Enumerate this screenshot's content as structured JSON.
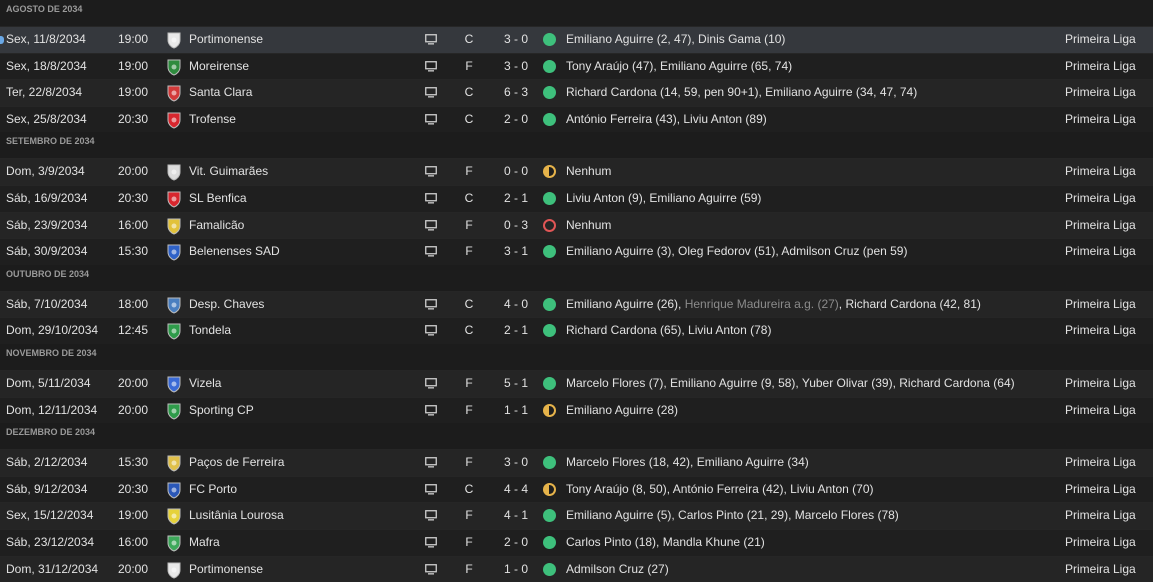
{
  "colors": {
    "win": "#3ec07c",
    "draw": "#e6b34a",
    "loss": "#e05656",
    "selected_row": "#35383d"
  },
  "icons": {
    "tv": "tv-icon",
    "badge": "club-badge-icon"
  },
  "months": [
    {
      "label": "AGOSTO DE 2034",
      "matches": [
        {
          "date": "Sex, 11/8/2034",
          "time": "19:00",
          "opponent": "Portimonense",
          "badge_color": "#e9e9e9",
          "venue": "C",
          "score": "3 - 0",
          "result": "win",
          "scorers": "Emiliano Aguirre (2, 47), Dinis Gama (10)",
          "competition": "Primeira Liga",
          "selected": true
        },
        {
          "date": "Sex, 18/8/2034",
          "time": "19:00",
          "opponent": "Moreirense",
          "badge_color": "#2e8b3e",
          "venue": "F",
          "score": "3 - 0",
          "result": "win",
          "scorers": "Tony Araújo (47), Emiliano Aguirre (65, 74)",
          "competition": "Primeira Liga"
        },
        {
          "date": "Ter, 22/8/2034",
          "time": "19:00",
          "opponent": "Santa Clara",
          "badge_color": "#d23a3a",
          "venue": "C",
          "score": "6 - 3",
          "result": "win",
          "scorers": "Richard Cardona (14, 59, pen 90+1), Emiliano Aguirre (34, 47, 74)",
          "competition": "Primeira Liga"
        },
        {
          "date": "Sex, 25/8/2034",
          "time": "20:30",
          "opponent": "Trofense",
          "badge_color": "#d8262e",
          "venue": "C",
          "score": "2 - 0",
          "result": "win",
          "scorers": "António Ferreira (43), Liviu Anton (89)",
          "competition": "Primeira Liga"
        }
      ]
    },
    {
      "label": "SETEMBRO DE 2034",
      "matches": [
        {
          "date": "Dom, 3/9/2034",
          "time": "20:00",
          "opponent": "Vit. Guimarães",
          "badge_color": "#dcdcdc",
          "venue": "F",
          "score": "0 - 0",
          "result": "draw",
          "scorers": "Nenhum",
          "competition": "Primeira Liga"
        },
        {
          "date": "Sáb, 16/9/2034",
          "time": "20:30",
          "opponent": "SL Benfica",
          "badge_color": "#d8262e",
          "venue": "C",
          "score": "2 - 1",
          "result": "win",
          "scorers": "Liviu Anton (9), Emiliano Aguirre (59)",
          "competition": "Primeira Liga"
        },
        {
          "date": "Sáb, 23/9/2034",
          "time": "16:00",
          "opponent": "Famalicão",
          "badge_color": "#e2c23a",
          "venue": "F",
          "score": "0 - 3",
          "result": "loss",
          "scorers": "Nenhum",
          "competition": "Primeira Liga"
        },
        {
          "date": "Sáb, 30/9/2034",
          "time": "15:30",
          "opponent": "Belenenses SAD",
          "badge_color": "#2f62c8",
          "venue": "F",
          "score": "3 - 1",
          "result": "win",
          "scorers": "Emiliano Aguirre (3), Oleg Fedorov (51), Admilson Cruz (pen 59)",
          "competition": "Primeira Liga"
        }
      ]
    },
    {
      "label": "OUTUBRO DE 2034",
      "matches": [
        {
          "date": "Sáb, 7/10/2034",
          "time": "18:00",
          "opponent": "Desp. Chaves",
          "badge_color": "#4a7fc0",
          "venue": "C",
          "score": "4 - 0",
          "result": "win",
          "scorers": "Emiliano Aguirre (26), ",
          "scorers_og": "Henrique Madureira a.g. (27)",
          "scorers_tail": ", Richard Cardona (42, 81)",
          "competition": "Primeira Liga"
        },
        {
          "date": "Dom, 29/10/2034",
          "time": "12:45",
          "opponent": "Tondela",
          "badge_color": "#2e9b4a",
          "venue": "C",
          "score": "2 - 1",
          "result": "win",
          "scorers": "Richard Cardona (65), Liviu Anton (78)",
          "competition": "Primeira Liga"
        }
      ]
    },
    {
      "label": "NOVEMBRO DE 2034",
      "matches": [
        {
          "date": "Dom, 5/11/2034",
          "time": "20:00",
          "opponent": "Vizela",
          "badge_color": "#3a6ad6",
          "venue": "F",
          "score": "5 - 1",
          "result": "win",
          "scorers": "Marcelo Flores (7), Emiliano Aguirre (9, 58), Yuber Olivar (39), Richard Cardona (64)",
          "competition": "Primeira Liga"
        },
        {
          "date": "Dom, 12/11/2034",
          "time": "20:00",
          "opponent": "Sporting CP",
          "badge_color": "#2e9b4a",
          "venue": "F",
          "score": "1 - 1",
          "result": "draw",
          "scorers": "Emiliano Aguirre (28)",
          "competition": "Primeira Liga"
        }
      ]
    },
    {
      "label": "DEZEMBRO DE 2034",
      "matches": [
        {
          "date": "Sáb, 2/12/2034",
          "time": "15:30",
          "opponent": "Paços de Ferreira",
          "badge_color": "#e0c04a",
          "venue": "F",
          "score": "3 - 0",
          "result": "win",
          "scorers": "Marcelo Flores (18, 42), Emiliano Aguirre (34)",
          "competition": "Primeira Liga"
        },
        {
          "date": "Sáb, 9/12/2034",
          "time": "20:30",
          "opponent": "FC Porto",
          "badge_color": "#2a57b8",
          "venue": "C",
          "score": "4 - 4",
          "result": "draw",
          "scorers": "Tony Araújo (8, 50), António Ferreira (42), Liviu Anton (70)",
          "competition": "Primeira Liga"
        },
        {
          "date": "Sex, 15/12/2034",
          "time": "19:00",
          "opponent": "Lusitânia Lourosa",
          "badge_color": "#e6d23a",
          "venue": "F",
          "score": "4 - 1",
          "result": "win",
          "scorers": "Emiliano Aguirre (5), Carlos Pinto (21, 29), Marcelo Flores (78)",
          "competition": "Primeira Liga"
        },
        {
          "date": "Sáb, 23/12/2034",
          "time": "16:00",
          "opponent": "Mafra",
          "badge_color": "#3da85a",
          "venue": "F",
          "score": "2 - 0",
          "result": "win",
          "scorers": "Carlos Pinto (18), Mandla Khune (21)",
          "competition": "Primeira Liga"
        },
        {
          "date": "Dom, 31/12/2034",
          "time": "20:00",
          "opponent": "Portimonense",
          "badge_color": "#e9e9e9",
          "venue": "F",
          "score": "1 - 0",
          "result": "win",
          "scorers": "Admilson Cruz (27)",
          "competition": "Primeira Liga"
        }
      ]
    }
  ]
}
